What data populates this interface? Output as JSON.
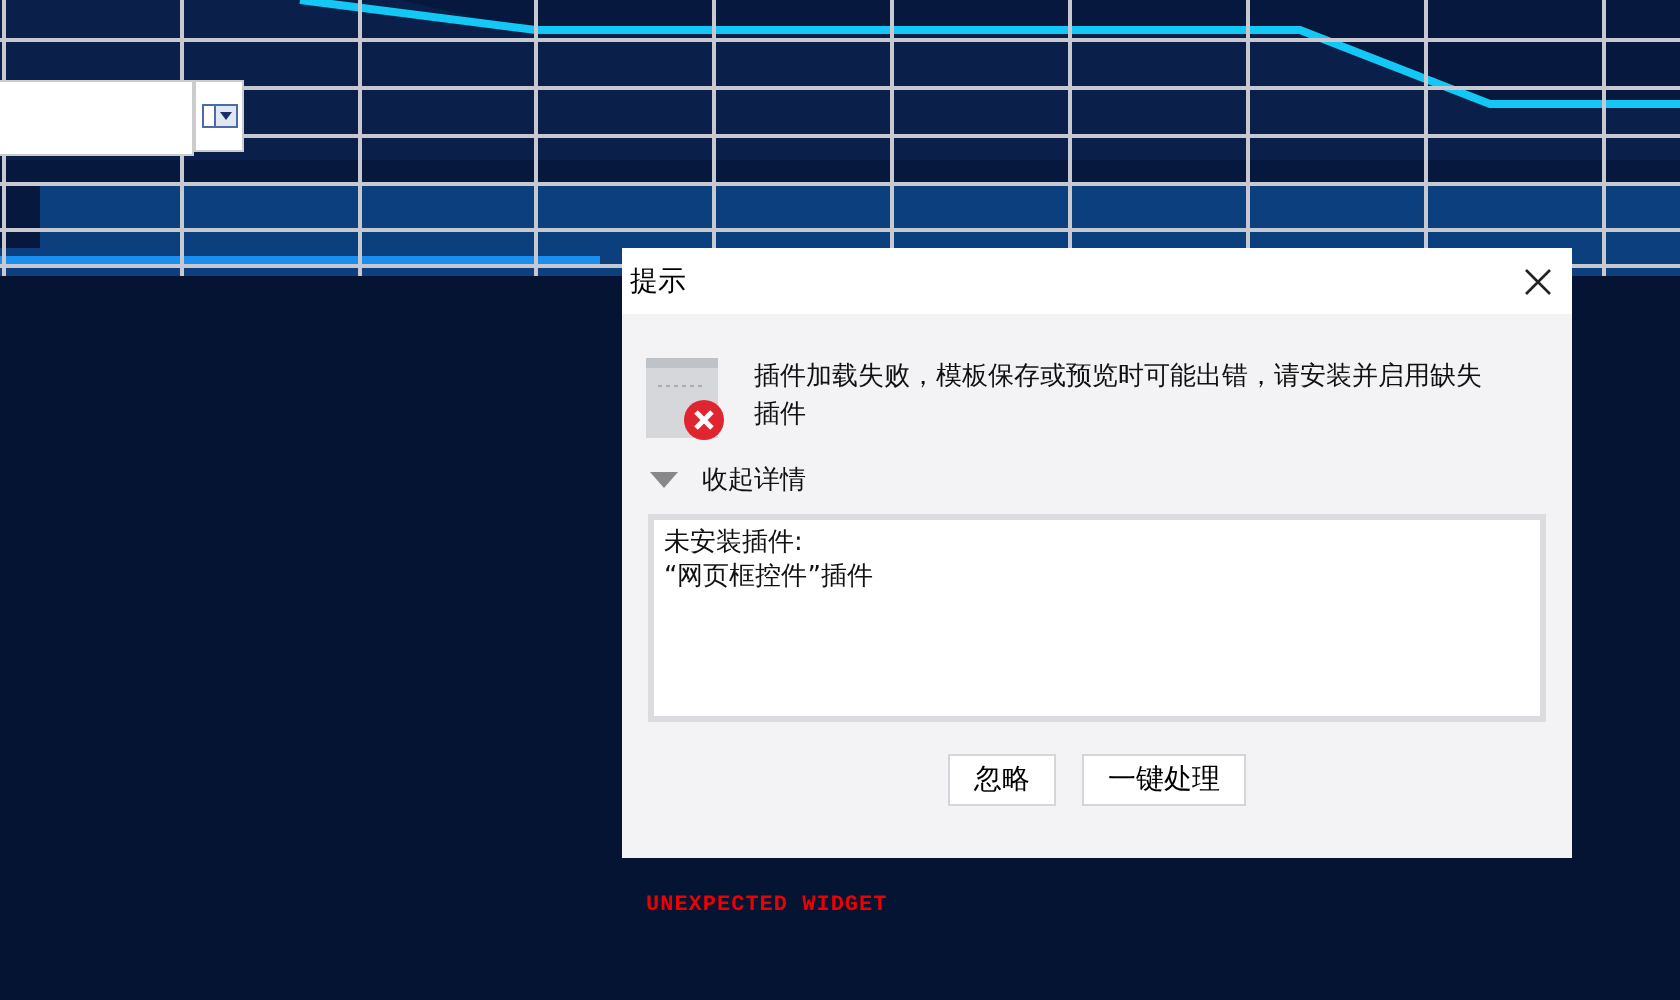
{
  "dialog": {
    "title": "提示",
    "message": "插件加载失败，模板保存或预览时可能出错，请安装并启用缺失插件",
    "details": {
      "label": "收起详情",
      "expanded": true,
      "lines": [
        "未安装插件:",
        "“网页框控件”插件"
      ]
    },
    "buttons": [
      "忽略",
      "一键处理"
    ]
  },
  "warning": "UNEXPECTED WIDGET"
}
